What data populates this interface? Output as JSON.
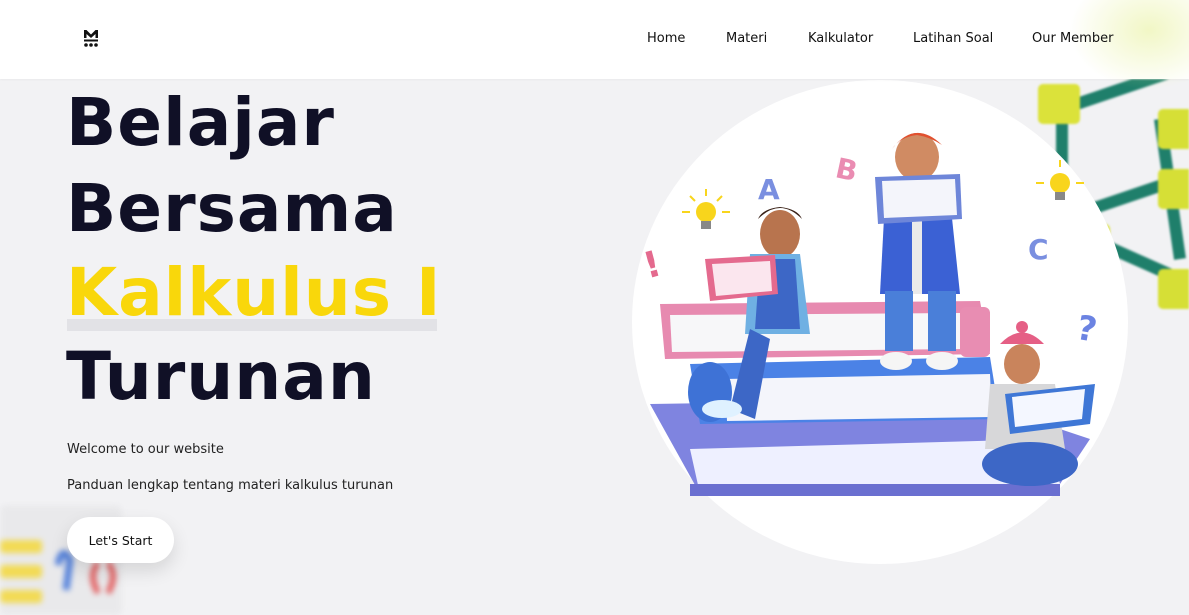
{
  "nav": {
    "logo_icon": "m-logo-icon",
    "links": [
      "Home",
      "Materi",
      "Kalkulator",
      "Latihan Soal",
      "Our Member"
    ]
  },
  "hero": {
    "title_lines": [
      "Belajar",
      "Bersama",
      "Kalkulus I",
      "Turunan"
    ],
    "welcome": "Welcome to our website",
    "description": "Panduan lengkap tentang materi kalkulus turunan",
    "cta_label": "Let's Start"
  },
  "illustration": {
    "name": "students-reading-books-illustration",
    "letters": [
      "A",
      "B",
      "C",
      "!",
      "?"
    ]
  },
  "colors": {
    "accent": "#f9d70b",
    "heading": "#101026",
    "background": "#f2f2f4"
  }
}
